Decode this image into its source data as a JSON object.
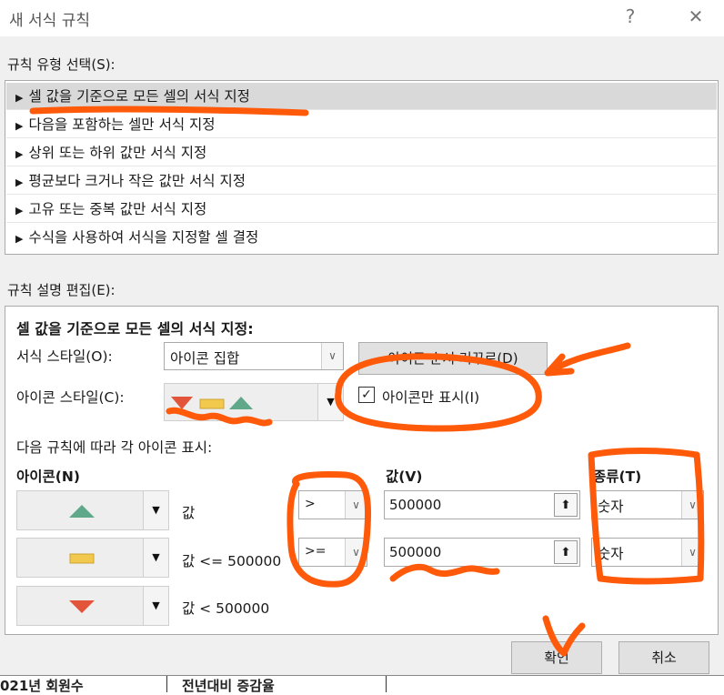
{
  "window": {
    "title": "새 서식 규칙",
    "help_glyph": "?",
    "close_glyph": "✕"
  },
  "rule_type": {
    "label": "규칙 유형 선택(S):",
    "items": [
      "셀 값을 기준으로 모든 셀의 서식 지정",
      "다음을 포함하는 셀만 서식 지정",
      "상위 또는 하위 값만 서식 지정",
      "평균보다 크거나 작은 값만 서식 지정",
      "고유 또는 중복 값만 서식 지정",
      "수식을 사용하여 서식을 지정할 셀 결정"
    ],
    "selected_index": 0
  },
  "edit": {
    "label": "규칙 설명 편집(E):",
    "heading": "셀 값을 기준으로 모든 셀의 서식 지정:",
    "format_style_label": "서식 스타일(O):",
    "format_style_value": "아이콘 집합",
    "reverse_button": "아이콘 순서 거꾸로(D)",
    "icon_style_label": "아이콘 스타일(C):",
    "icon_only_label": "아이콘만 표시(I)",
    "icon_only_checked": true,
    "rules_caption": "다음 규칙에 따라 각 아이콘 표시:",
    "col_icon": "아이콘(N)",
    "col_value": "값(V)",
    "col_type": "종류(T)",
    "rows": [
      {
        "icon": "up-triangle-green",
        "cond_text": "값",
        "operator": ">",
        "value": "500000",
        "type": "숫자"
      },
      {
        "icon": "bar-yellow",
        "cond_text": "값 <= 500000",
        "operator": ">=",
        "value": "500000",
        "type": "숫자"
      },
      {
        "icon": "down-triangle-red",
        "cond_text": "값 < 500000"
      }
    ]
  },
  "buttons": {
    "ok": "확인",
    "cancel": "취소"
  },
  "background_sheet": {
    "fragment1": "021년 회원수",
    "fragment2": "전년대비 증감율"
  },
  "colors": {
    "green": "#5fa88a",
    "yellow": "#f2c94c",
    "red": "#e2553a",
    "annotation": "#ff5a0a"
  }
}
